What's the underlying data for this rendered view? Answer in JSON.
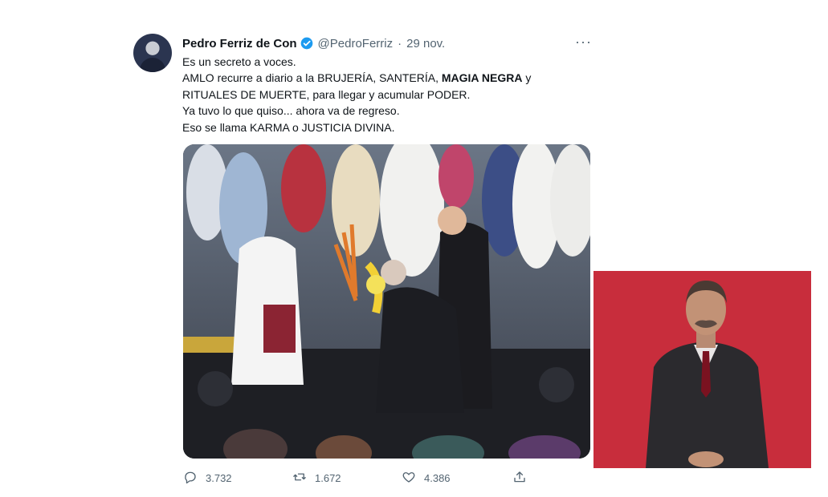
{
  "tweet": {
    "author_name": "Pedro Ferriz de Con",
    "handle": "@PedroFerriz",
    "separator": "·",
    "date": "29 nov.",
    "more_label": "···",
    "lines": {
      "l1": "Es un secreto a voces.",
      "l2a": "AMLO recurre a diario a la BRUJERÍA, SANTERÍA, ",
      "l2b": "MAGIA NEGRA",
      "l2c": " y",
      "l3": "RITUALES DE MUERTE, para llegar y acumular PODER.",
      "l4": "Ya tuvo lo que quiso... ahora va de regreso.",
      "l5": "Eso se llama KARMA o JUSTICIA DIVINA."
    },
    "stats": {
      "replies": "3.732",
      "retweets": "1.672",
      "likes": "4.386"
    }
  },
  "icons": {
    "verified": "verified-badge-icon",
    "reply": "reply-icon",
    "retweet": "retweet-icon",
    "like": "heart-icon",
    "share": "share-icon",
    "more": "more-dots-icon"
  },
  "colors": {
    "verified_blue": "#1d9bf0",
    "muted_text": "#536471",
    "interpreter_bg": "#c82d3c"
  }
}
